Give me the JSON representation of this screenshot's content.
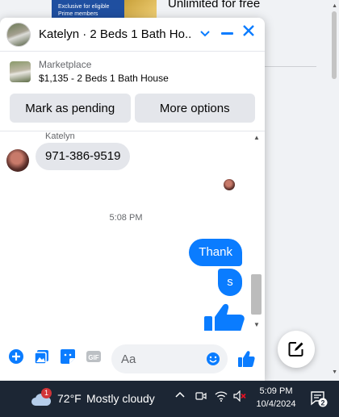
{
  "background": {
    "ad_text": "Exclusive for eligible Prime members",
    "heading": "Unlimited for free"
  },
  "chat": {
    "header_title": "Katelyn · 2 Beds 1 Bath Ho...",
    "listing": {
      "label": "Marketplace",
      "description": "$1,135 - 2 Beds 1 Bath House"
    },
    "actions": {
      "mark_pending": "Mark as pending",
      "more_options": "More options"
    },
    "messages": {
      "sender_name": "Katelyn",
      "incoming": "971-386-9519",
      "timestamp": "5:08 PM",
      "outgoing_1": "Thank",
      "outgoing_2": "s"
    },
    "composer": {
      "placeholder": "Aa"
    },
    "accent_color": "#0a7cff"
  },
  "taskbar": {
    "weather_badge": "1",
    "temperature": "72°F",
    "condition": "Mostly cloudy",
    "time": "5:09 PM",
    "date": "10/4/2024",
    "notification_count": "2"
  }
}
